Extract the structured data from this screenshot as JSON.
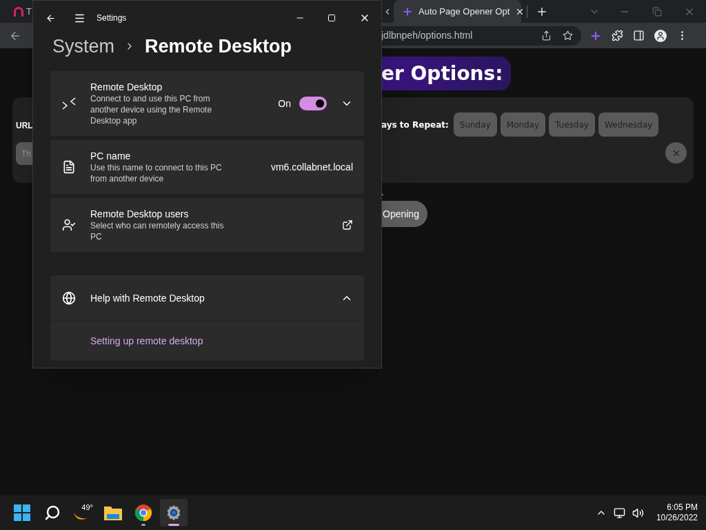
{
  "browser": {
    "tabs": [
      {
        "title": "T",
        "selected": false
      },
      {
        "title": "Auto Page Opener Opt",
        "selected": true
      }
    ],
    "address": "jdlbnpeh/options.html",
    "page": {
      "heading": "er Options:",
      "url_label": "URL",
      "url_field_value": "Th",
      "days_label": "ays to Repeat:",
      "days": [
        "Sunday",
        "Monday",
        "Tuesday",
        "Wednesday"
      ],
      "note": ".",
      "button": "Opening"
    }
  },
  "settings": {
    "title": "Settings",
    "breadcrumb": {
      "parent": "System",
      "current": "Remote Desktop"
    },
    "items": [
      {
        "kind": "toggle",
        "title": "Remote Desktop",
        "description": "Connect to and use this PC from another device using the Remote Desktop app",
        "state_label": "On",
        "on": true,
        "expanded": false
      },
      {
        "kind": "value",
        "title": "PC name",
        "description": "Use this name to connect to this PC from another device",
        "value": "vm6.collabnet.local"
      },
      {
        "kind": "link",
        "title": "Remote Desktop users",
        "description": "Select who can remotely access this PC"
      }
    ],
    "help": {
      "title": "Help with Remote Desktop",
      "expanded": true,
      "links": [
        "Setting up remote desktop"
      ]
    }
  },
  "taskbar": {
    "apps": [
      {
        "kind": "start",
        "running": false,
        "selected": false
      },
      {
        "kind": "search",
        "running": false,
        "selected": false
      },
      {
        "kind": "weather",
        "label": "49°",
        "running": false,
        "selected": false
      },
      {
        "kind": "explorer",
        "running": false,
        "selected": false
      },
      {
        "kind": "chrome",
        "running": true,
        "selected": false
      },
      {
        "kind": "settings",
        "running": true,
        "selected": true
      }
    ],
    "time": "6:05 PM",
    "date": "10/26/2022"
  }
}
